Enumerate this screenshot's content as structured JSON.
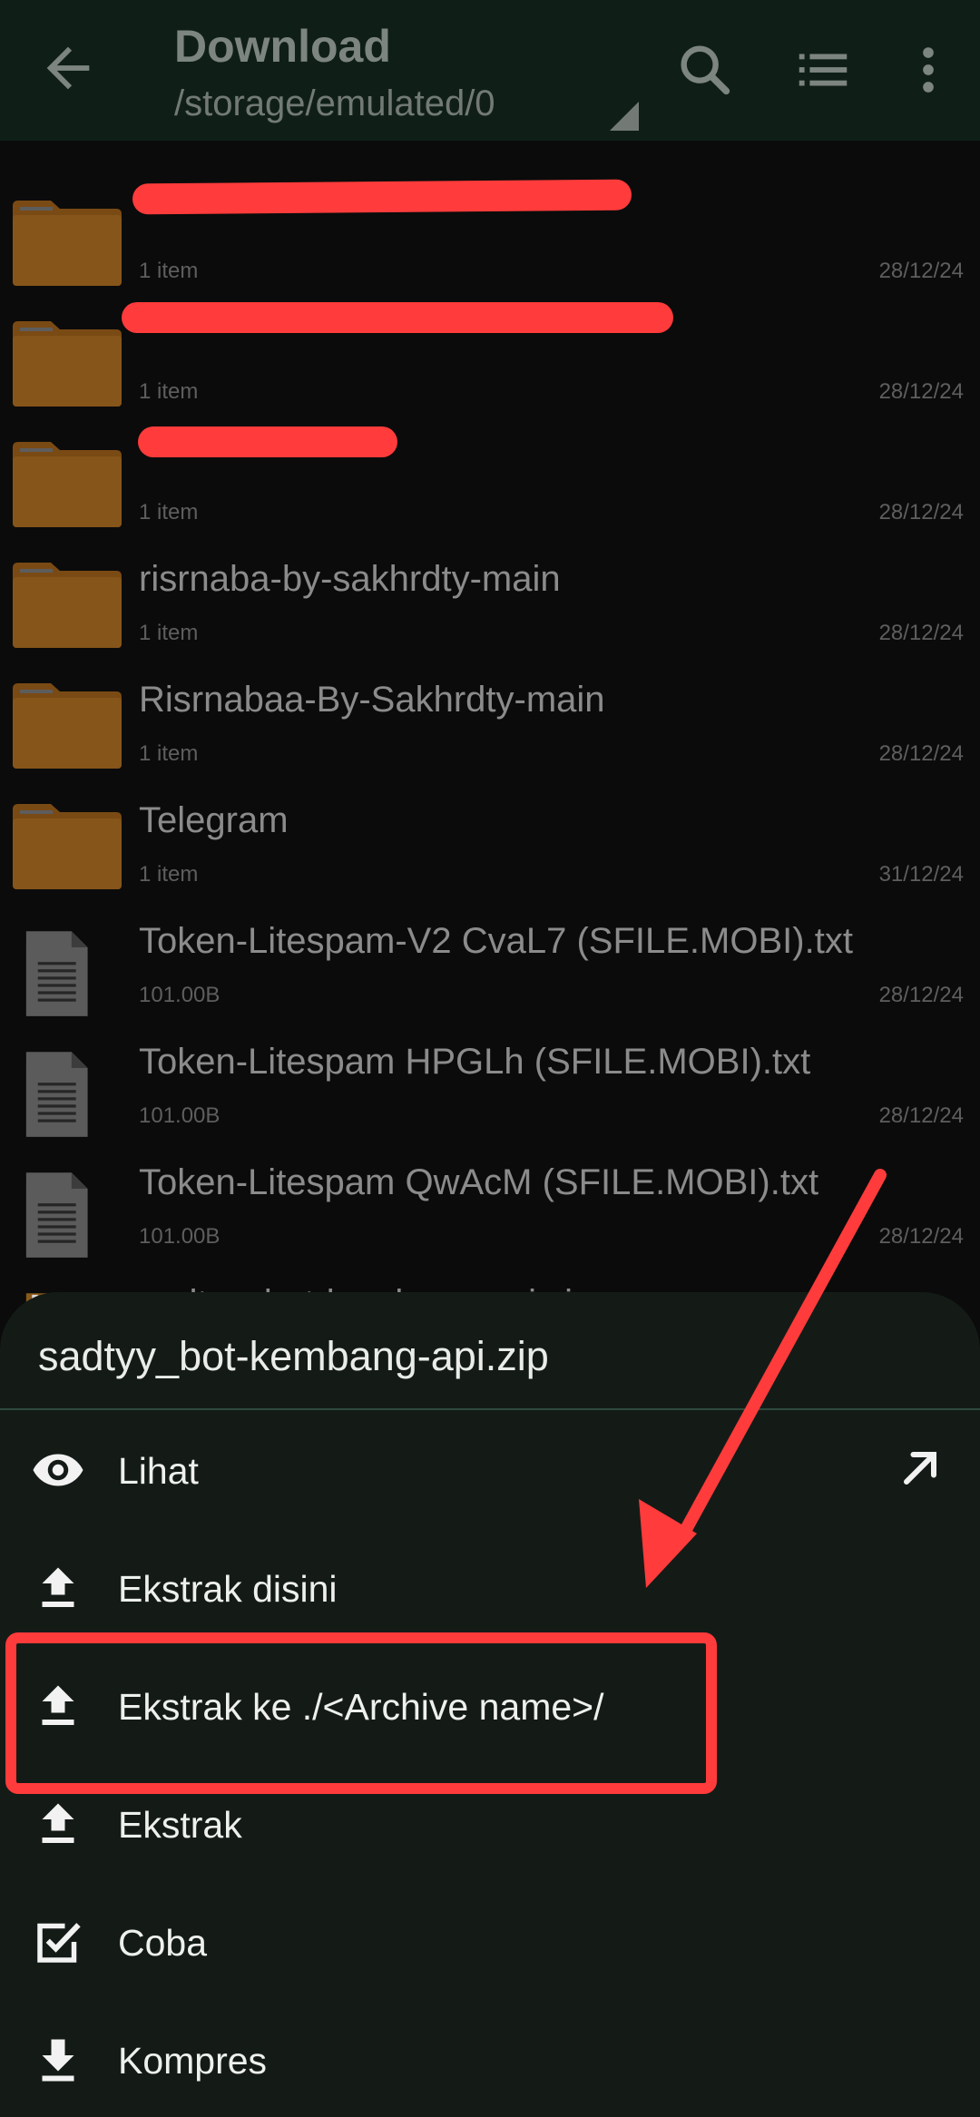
{
  "appbar": {
    "title": "Download",
    "path": "/storage/emulated/0",
    "icons": [
      "back-arrow-icon",
      "search-icon",
      "list-view-icon",
      "more-vert-icon"
    ]
  },
  "files": [
    {
      "name": "",
      "meta": "1 item",
      "date": "28/12/24",
      "type": "folder",
      "redacted": true
    },
    {
      "name": "",
      "meta": "1 item",
      "date": "28/12/24",
      "type": "folder",
      "redacted": true
    },
    {
      "name": "",
      "meta": "1 item",
      "date": "28/12/24",
      "type": "folder",
      "redacted": true
    },
    {
      "name": "risrnaba-by-sakhrdty-main",
      "meta": "1 item",
      "date": "28/12/24",
      "type": "folder"
    },
    {
      "name": "Risrnabaa-By-Sakhrdty-main",
      "meta": "1 item",
      "date": "28/12/24",
      "type": "folder"
    },
    {
      "name": "Telegram",
      "meta": "1 item",
      "date": "31/12/24",
      "type": "folder"
    },
    {
      "name": "Token-Litespam-V2 CvaL7 (SFILE.MOBI).txt",
      "meta": "101.00B",
      "date": "28/12/24",
      "type": "text"
    },
    {
      "name": "Token-Litespam HPGLh (SFILE.MOBI).txt",
      "meta": "101.00B",
      "date": "28/12/24",
      "type": "text"
    },
    {
      "name": "Token-Litespam QwAcM (SFILE.MOBI).txt",
      "meta": "101.00B",
      "date": "28/12/24",
      "type": "text"
    },
    {
      "name": "sadtyy_bot-kembang-api.zip",
      "meta": "",
      "date": "",
      "type": "zip"
    }
  ],
  "sheet": {
    "title": "sadtyy_bot-kembang-api.zip",
    "items": [
      {
        "label": "Lihat",
        "icon": "eye-icon"
      },
      {
        "label": "Ekstrak disini",
        "icon": "upload-icon"
      },
      {
        "label": "Ekstrak ke ./<Archive name>/",
        "icon": "upload-icon"
      },
      {
        "label": "Ekstrak",
        "icon": "upload-icon"
      },
      {
        "label": "Coba",
        "icon": "checkbox-icon"
      },
      {
        "label": "Kompres",
        "icon": "download-icon"
      }
    ]
  },
  "colors": {
    "appbar_bg": "#0f1f18",
    "sheet_bg": "#141b17",
    "annotation_red": "#ff3b3b",
    "folder": "#7a4a14"
  }
}
